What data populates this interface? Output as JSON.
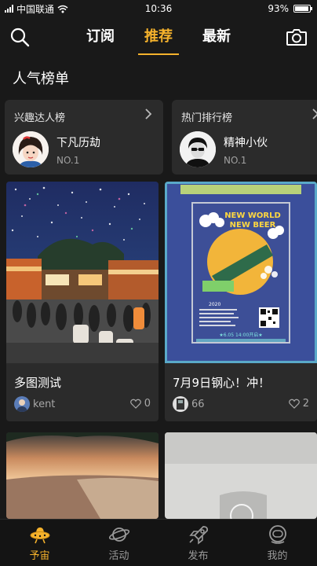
{
  "status_bar": {
    "carrier": "中国联通",
    "time": "10:36",
    "battery": "93%",
    "battery_level": 0.93
  },
  "header": {
    "search_icon": "search-icon",
    "camera_icon": "camera-icon",
    "tabs": [
      {
        "label": "订阅",
        "active": false
      },
      {
        "label": "推荐",
        "active": true
      },
      {
        "label": "最新",
        "active": false
      }
    ],
    "accent_color": "#f5b22c"
  },
  "section": {
    "title": "人气榜单"
  },
  "rank_cards": [
    {
      "title": "兴趣达人榜",
      "user_name": "下凡历劫",
      "rank": "NO.1",
      "icon": "chevron-right-icon"
    },
    {
      "title": "热门排行榜",
      "user_name": "精神小伙",
      "rank": "NO.1",
      "icon": "chevron-right-icon"
    }
  ],
  "posts": [
    {
      "title": "多图测试",
      "author": "kent",
      "likes": "0"
    },
    {
      "title": "7月9日钢心！冲！",
      "author": "66",
      "likes": "2"
    }
  ],
  "bottom_nav": [
    {
      "label": "予宙",
      "icon": "ufo-icon",
      "active": true
    },
    {
      "label": "活动",
      "icon": "planet-icon",
      "active": false
    },
    {
      "label": "发布",
      "icon": "rocket-icon",
      "active": false
    },
    {
      "label": "我的",
      "icon": "astronaut-icon",
      "active": false
    }
  ]
}
